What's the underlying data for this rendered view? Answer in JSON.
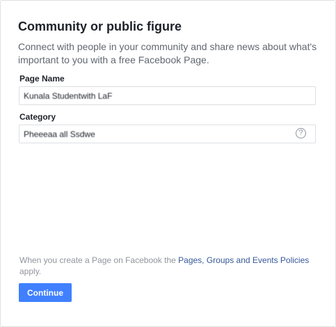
{
  "header": {
    "title": "Community or public figure",
    "subtitle": "Connect with people in your community and share news about what's important to you with a free Facebook Page."
  },
  "form": {
    "page_name_label": "Page Name",
    "page_name_value": "Kunala Studentwith LaF",
    "category_label": "Category",
    "category_value": "Pheeeaa all Ssdwe",
    "category_help": "?"
  },
  "footer": {
    "policy_prefix": "When you create a Page on Facebook the ",
    "policy_link": "Pages, Groups and Events Policies",
    "policy_suffix": " apply.",
    "continue_label": "Continue"
  },
  "colors": {
    "primary_button": "#4080ff",
    "link": "#365899"
  }
}
